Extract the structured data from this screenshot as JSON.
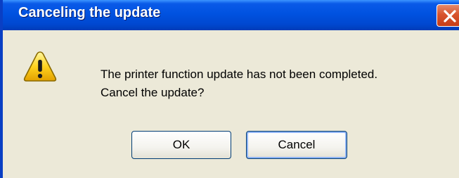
{
  "window": {
    "title": "Canceling the update",
    "close_icon": "close-icon"
  },
  "dialog": {
    "icon": "warning-icon",
    "message_line1": "The printer function update has not been completed.",
    "message_line2": "Cancel the update?"
  },
  "buttons": {
    "ok_label": "OK",
    "cancel_label": "Cancel"
  },
  "colors": {
    "titlebar": "#0052e0",
    "dialog_bg": "#ece9d8",
    "close_button": "#d8542e"
  }
}
